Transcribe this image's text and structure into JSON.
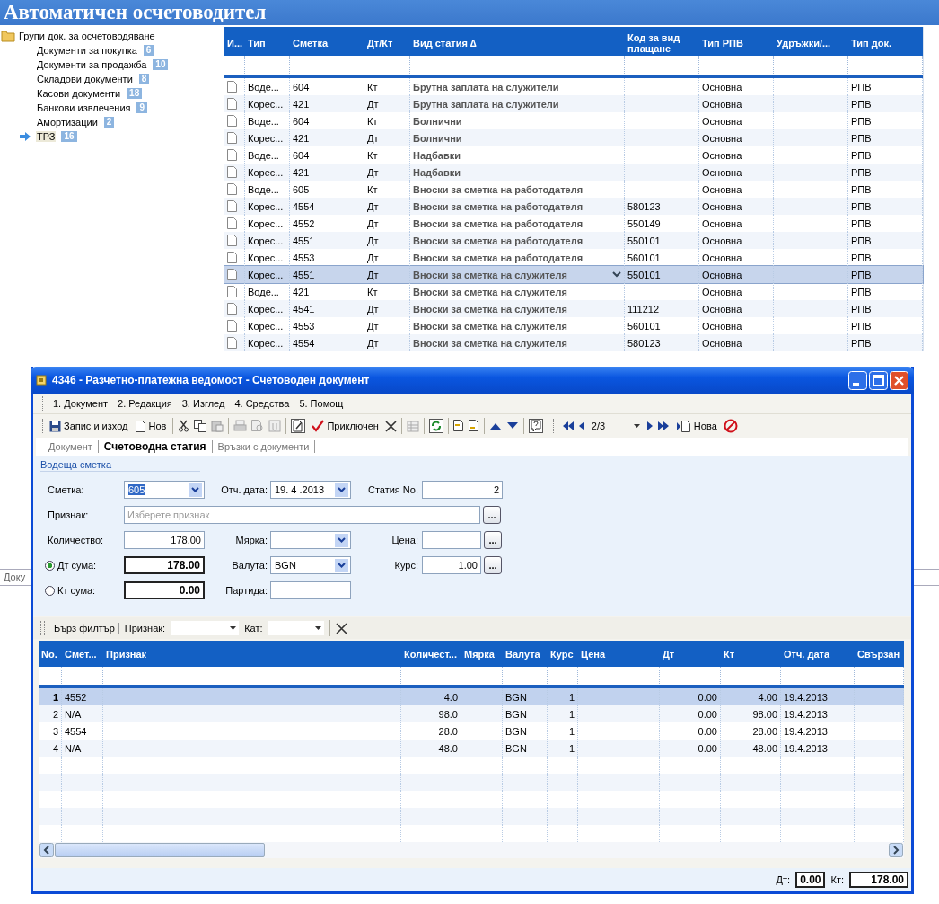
{
  "app_title": "Автоматичен осчетоводител",
  "tree": {
    "label": "Групи док. за осчетоводяване",
    "children": [
      {
        "label": "Документи за покупка",
        "count": "6",
        "selected": false
      },
      {
        "label": "Документи за продажба",
        "count": "10",
        "selected": false
      },
      {
        "label": "Складови документи",
        "count": "8",
        "selected": false
      },
      {
        "label": "Касови документи",
        "count": "18",
        "selected": false
      },
      {
        "label": "Банкови извлечения",
        "count": "9",
        "selected": false
      },
      {
        "label": "Амортизации",
        "count": "2",
        "selected": false
      },
      {
        "label": "ТРЗ",
        "count": "16",
        "selected": true
      }
    ]
  },
  "entries_table": {
    "columns": [
      "И...",
      "Тип",
      "Сметка",
      "Дт/Кт",
      "Вид статия ∆",
      "Код за вид плащане",
      "Тип РПВ",
      "Удръжки/...",
      "Тип док."
    ],
    "rows": [
      {
        "type": "Воде...",
        "account": "604",
        "side": "Кт",
        "item": "Брутна заплата на служители",
        "rpv_type": "Основна",
        "doc_type": "РПВ",
        "selected": false
      },
      {
        "type": "Корес...",
        "account": "421",
        "side": "Дт",
        "item": "Брутна заплата на служители",
        "rpv_type": "Основна",
        "doc_type": "РПВ",
        "selected": false
      },
      {
        "type": "Воде...",
        "account": "604",
        "side": "Кт",
        "item": "Болнични",
        "rpv_type": "Основна",
        "doc_type": "РПВ",
        "selected": false
      },
      {
        "type": "Корес...",
        "account": "421",
        "side": "Дт",
        "item": "Болнични",
        "rpv_type": "Основна",
        "doc_type": "РПВ",
        "selected": false
      },
      {
        "type": "Воде...",
        "account": "604",
        "side": "Кт",
        "item": "Надбавки",
        "rpv_type": "Основна",
        "doc_type": "РПВ",
        "selected": false
      },
      {
        "type": "Корес...",
        "account": "421",
        "side": "Дт",
        "item": "Надбавки",
        "rpv_type": "Основна",
        "doc_type": "РПВ",
        "selected": false
      },
      {
        "type": "Воде...",
        "account": "605",
        "side": "Кт",
        "item": "Вноски за сметка на работодателя",
        "rpv_type": "Основна",
        "doc_type": "РПВ",
        "selected": false
      },
      {
        "type": "Корес...",
        "account": "4554",
        "side": "Дт",
        "item": "Вноски за сметка на работодателя",
        "payment_code": "580123",
        "rpv_type": "Основна",
        "doc_type": "РПВ",
        "selected": false
      },
      {
        "type": "Корес...",
        "account": "4552",
        "side": "Дт",
        "item": "Вноски за сметка на работодателя",
        "payment_code": "550149",
        "rpv_type": "Основна",
        "doc_type": "РПВ",
        "selected": false
      },
      {
        "type": "Корес...",
        "account": "4551",
        "side": "Дт",
        "item": "Вноски за сметка на работодателя",
        "payment_code": "550101",
        "rpv_type": "Основна",
        "doc_type": "РПВ",
        "selected": false
      },
      {
        "type": "Корес...",
        "account": "4553",
        "side": "Дт",
        "item": "Вноски за сметка на работодателя",
        "payment_code": "560101",
        "rpv_type": "Основна",
        "doc_type": "РПВ",
        "selected": false
      },
      {
        "type": "Корес...",
        "account": "4551",
        "side": "Дт",
        "item": "Вноски за сметка на служителя",
        "payment_code": "550101",
        "rpv_type": "Основна",
        "doc_type": "РПВ",
        "selected": true
      },
      {
        "type": "Воде...",
        "account": "421",
        "side": "Кт",
        "item": "Вноски за сметка на служителя",
        "rpv_type": "Основна",
        "doc_type": "РПВ",
        "selected": false
      },
      {
        "type": "Корес...",
        "account": "4541",
        "side": "Дт",
        "item": "Вноски за сметка на служителя",
        "payment_code": "111212",
        "rpv_type": "Основна",
        "doc_type": "РПВ",
        "selected": false
      },
      {
        "type": "Корес...",
        "account": "4553",
        "side": "Дт",
        "item": "Вноски за сметка на служителя",
        "payment_code": "560101",
        "rpv_type": "Основна",
        "doc_type": "РПВ",
        "selected": false
      },
      {
        "type": "Корес...",
        "account": "4554",
        "side": "Дт",
        "item": "Вноски за сметка на служителя",
        "payment_code": "580123",
        "rpv_type": "Основна",
        "doc_type": "РПВ",
        "selected": false
      }
    ]
  },
  "behind_tab": "Доку",
  "dialog": {
    "title": "4346 - Разчетно-платежна ведомост - Счетоводен документ",
    "menu": [
      "1. Документ",
      "2. Редакция",
      "3. Изглед",
      "4. Средства",
      "5. Помощ"
    ],
    "toolbar": {
      "save": "Запис и изход",
      "new": "Нов",
      "done": "Приключен",
      "page": "2/3",
      "new_doc": "Нова"
    },
    "tabs": [
      {
        "label": "Документ",
        "selected": false
      },
      {
        "label": "Счетоводна статия",
        "selected": true
      },
      {
        "label": "Връзки с документи",
        "selected": false
      }
    ],
    "form": {
      "section": "Водеща сметка",
      "account": {
        "label": "Сметка:",
        "value": "605"
      },
      "date": {
        "label": "Отч. дата:",
        "value": "19. 4 .2013"
      },
      "entry_no": {
        "label": "Статия No.",
        "value": "2"
      },
      "attribute": {
        "label": "Признак:",
        "placeholder": "Изберете признак",
        "button": "..."
      },
      "quantity": {
        "label": "Количество:",
        "value": "178.00"
      },
      "unit": {
        "label": "Мярка:"
      },
      "price": {
        "label": "Цена:",
        "button": "..."
      },
      "debit": {
        "label": "Дт сума:",
        "value": "178.00",
        "selected": true
      },
      "currency": {
        "label": "Валута:",
        "value": "BGN"
      },
      "rate": {
        "label": "Курс:",
        "value": "1.00",
        "button": "..."
      },
      "credit": {
        "label": "Кт сума:",
        "value": "0.00",
        "selected": false
      },
      "batch": {
        "label": "Партида:"
      }
    },
    "quick_filter": {
      "label": "Бърз филтър",
      "attribute_label": "Признак:",
      "category_label": "Кат:"
    },
    "lines_table": {
      "columns": [
        "No.",
        "Смет...",
        "Признак",
        "Количест...",
        "Мярка",
        "Валута",
        "Курс",
        "Цена",
        "Дт",
        "Кт",
        "Отч. дата",
        "Свързан"
      ],
      "rows": [
        {
          "no": "1",
          "account": "4552",
          "quantity": "4.0",
          "currency": "BGN",
          "rate": "1",
          "debit": "0.00",
          "credit": "4.00",
          "date": "19.4.2013",
          "selected": true
        },
        {
          "no": "2",
          "account": "N/A",
          "quantity": "98.0",
          "currency": "BGN",
          "rate": "1",
          "debit": "0.00",
          "credit": "98.00",
          "date": "19.4.2013",
          "selected": false
        },
        {
          "no": "3",
          "account": "4554",
          "quantity": "28.0",
          "currency": "BGN",
          "rate": "1",
          "debit": "0.00",
          "credit": "28.00",
          "date": "19.4.2013",
          "selected": false
        },
        {
          "no": "4",
          "account": "N/A",
          "quantity": "48.0",
          "currency": "BGN",
          "rate": "1",
          "debit": "0.00",
          "credit": "48.00",
          "date": "19.4.2013",
          "selected": false
        }
      ]
    },
    "totals": {
      "debit_label": "Дт:",
      "debit": "0.00",
      "credit_label": "Кт:",
      "credit": "178.00"
    }
  }
}
